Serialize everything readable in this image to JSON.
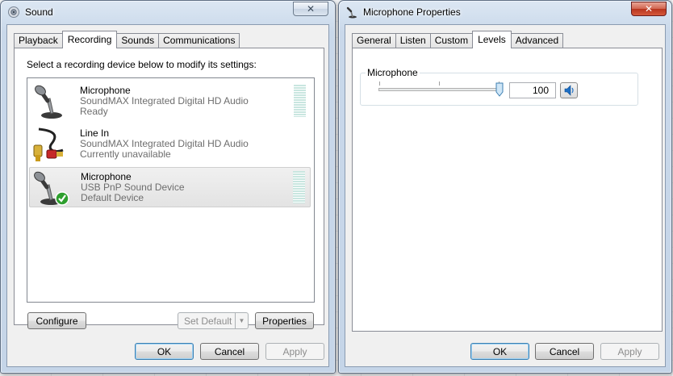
{
  "sound": {
    "title": "Sound",
    "close": "✕",
    "tabs": [
      "Playback",
      "Recording",
      "Sounds",
      "Communications"
    ],
    "instruction": "Select a recording device below to modify its settings:",
    "devices": [
      {
        "name": "Microphone",
        "driver": "SoundMAX Integrated Digital HD Audio",
        "status": "Ready",
        "icon": "microphone-icon"
      },
      {
        "name": "Line In",
        "driver": "SoundMAX Integrated Digital HD Audio",
        "status": "Currently unavailable",
        "icon": "line-in-cable-icon"
      },
      {
        "name": "Microphone",
        "driver": "USB PnP Sound Device",
        "status": "Default Device",
        "icon": "microphone-default-icon"
      }
    ],
    "configure": "Configure",
    "set_default": "Set Default",
    "set_default_arrow": "▼",
    "properties": "Properties",
    "ok": "OK",
    "cancel": "Cancel",
    "apply": "Apply"
  },
  "mic_props": {
    "title": "Microphone Properties",
    "close": "✕",
    "tabs": [
      "General",
      "Listen",
      "Custom",
      "Levels",
      "Advanced"
    ],
    "group_label": "Microphone",
    "level_value": "100",
    "level": 1.0,
    "ok": "OK",
    "cancel": "Cancel",
    "apply": "Apply"
  },
  "colors": {
    "title_bar": "#c9d8ea",
    "close_red": "#c7412a",
    "default_check": "#2e9f2e"
  }
}
